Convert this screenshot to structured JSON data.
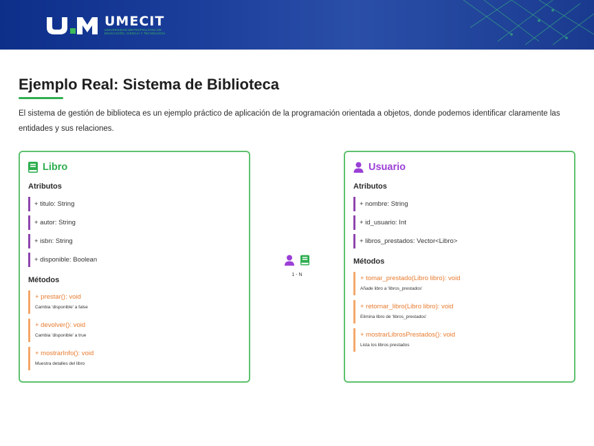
{
  "header": {
    "logo_name": "UMECIT",
    "logo_mark": "UM",
    "logo_subtitle_line1": "UNIVERSIDAD METROPOLITANA DE",
    "logo_subtitle_line2": "EDUCACIÓN, CIENCIA Y TECNOLOGÍA",
    "bg_color": "#1c3f9c",
    "accent_color": "#3dbb5a"
  },
  "page": {
    "title": "Ejemplo Real: Sistema de Biblioteca",
    "intro": "El sistema de gestión de biblioteca es un ejemplo práctico de aplicación de la programación orientada a objetos, donde podemos identificar claramente las entidades y sus relaciones."
  },
  "libro": {
    "icon": "book-icon",
    "title": "Libro",
    "attributes_title": "Atributos",
    "attributes": [
      "+ titulo: String",
      "+ autor: String",
      "+ isbn: String",
      "+ disponible: Boolean"
    ],
    "methods_title": "Métodos",
    "methods": [
      {
        "signature": "+ prestar(): void",
        "description": "Cambia 'disponible' a false"
      },
      {
        "signature": "+ devolver(): void",
        "description": "Cambia 'disponible' a true"
      },
      {
        "signature": "+ mostrarInfo(): void",
        "description": "Muestra detalles del libro"
      }
    ]
  },
  "usuario": {
    "icon": "user-icon",
    "title": "Usuario",
    "attributes_title": "Atributos",
    "attributes": [
      "+ nombre: String",
      "+ id_usuario: Int",
      "+ libros_prestados: Vector<Libro>"
    ],
    "methods_title": "Métodos",
    "methods": [
      {
        "signature": "+ tomar_prestado(Libro libro): void",
        "description": "Añade libro a 'libros_prestados'"
      },
      {
        "signature": "+ retornar_libro(Libro libro): void",
        "description": "Elimina libro de 'libros_prestados'"
      },
      {
        "signature": "+ mostrarLibrosPrestados(): void",
        "description": "Lista los libros prestados"
      }
    ]
  },
  "relation": {
    "label": "1 - N",
    "icons": [
      "user-icon",
      "book-icon"
    ]
  },
  "colors": {
    "green": "#2eae4f",
    "purple": "#9b3fd6",
    "attr_border": "#8e44ad",
    "method_border": "#f4a76a",
    "method_text": "#e87a2d",
    "card_border": "#5cc06c"
  }
}
